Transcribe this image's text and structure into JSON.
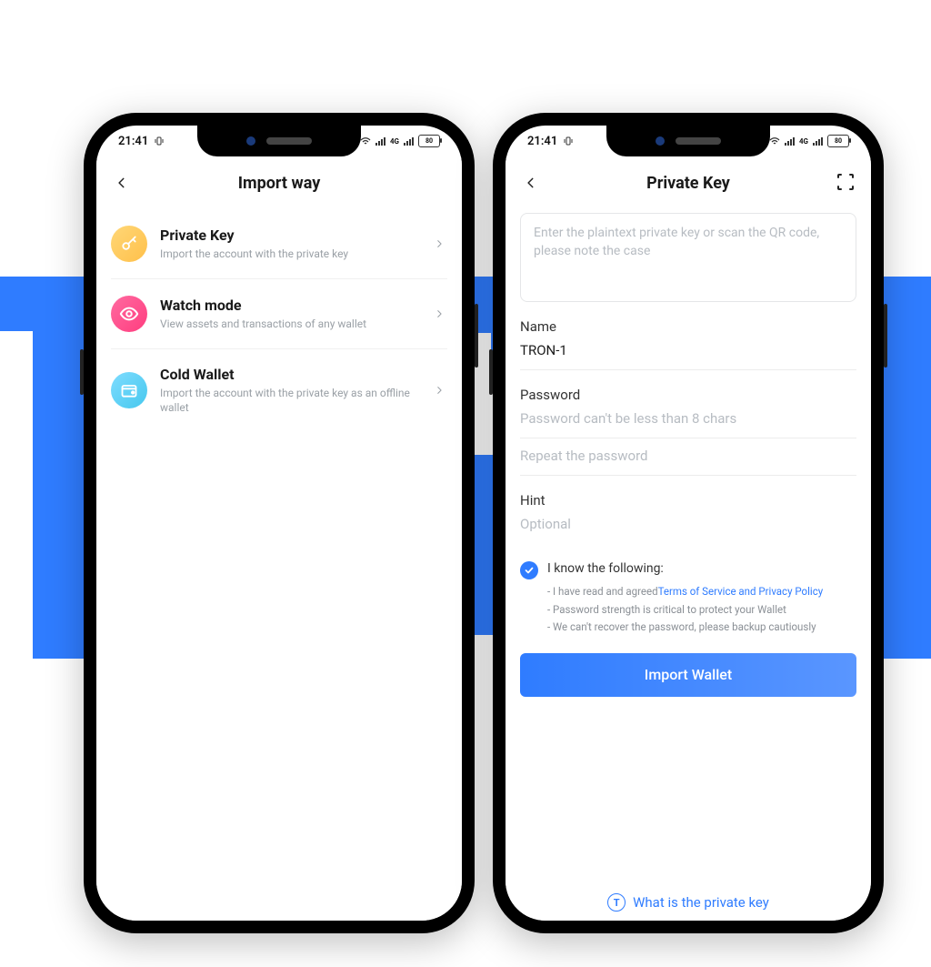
{
  "status_bar": {
    "time": "21:41",
    "battery": "80"
  },
  "left_phone": {
    "title": "Import way",
    "options": [
      {
        "title": "Private Key",
        "subtitle": "Import the account with the private key"
      },
      {
        "title": "Watch mode",
        "subtitle": "View assets and transactions of any wallet"
      },
      {
        "title": "Cold Wallet",
        "subtitle": "Import the account with the private key as an offline wallet"
      }
    ]
  },
  "right_phone": {
    "title": "Private Key",
    "pk_placeholder": "Enter the plaintext private key or scan the QR code, please note the case",
    "name_label": "Name",
    "name_value": "TRON-1",
    "password_label": "Password",
    "password_placeholder": "Password can't be less than 8 chars",
    "repeat_placeholder": "Repeat the password",
    "hint_label": "Hint",
    "hint_placeholder": "Optional",
    "ack_header": "I know the following:",
    "ack_point1_prefix": "- I have read and agreed",
    "ack_point1_link": "Terms of Service and Privacy Policy",
    "ack_point2": "- Password strength is critical to protect your Wallet",
    "ack_point3": "- We can't recover the password, please backup cautiously",
    "primary_button": "Import Wallet",
    "help_link": "What is the private key"
  }
}
